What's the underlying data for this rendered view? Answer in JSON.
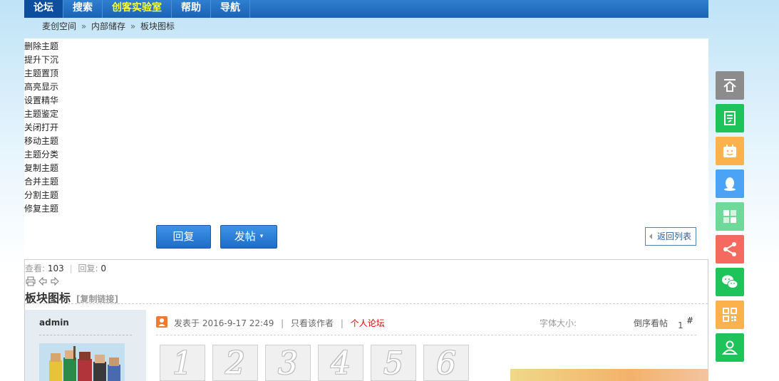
{
  "nav": {
    "items": [
      {
        "label": "论坛"
      },
      {
        "label": "搜索"
      },
      {
        "label": "创客实验室"
      },
      {
        "label": "帮助"
      },
      {
        "label": "导航"
      }
    ]
  },
  "breadcrumb": {
    "items": [
      "麦创空间",
      "内部储存",
      "板块图标"
    ],
    "separator": "»"
  },
  "moderation": {
    "items": [
      "删除主题",
      "提升下沉",
      "主题置顶",
      "高亮显示",
      "设置精华",
      "主题鉴定",
      "关闭打开",
      "移动主题",
      "主题分类",
      "复制主题",
      "合并主题",
      "分割主题",
      "修复主题"
    ]
  },
  "actions": {
    "reply_label": "回复",
    "post_label": "发帖",
    "post_caret": "▾",
    "back_label": "返回列表"
  },
  "thread": {
    "views_label": "查看:",
    "views": "103",
    "replies_label": "回复:",
    "replies": "0",
    "title": "板块图标",
    "copy_link_label": "[复制链接]"
  },
  "post": {
    "author": "admin",
    "posted_prefix": "发表于",
    "posted_time": "2016-9-17 22:49",
    "only_author_label": "只看该作者",
    "personal_forum_label": "个人论坛",
    "font_size_label": "字体大小:",
    "reverse_label": "倒序看帖",
    "floor_number": "1",
    "floor_hash": "#"
  },
  "number_icons": [
    "1",
    "2",
    "3",
    "4",
    "5",
    "6"
  ],
  "colors": {
    "nav_bg": "#1b62b4",
    "nav_active": "#0d4f9e",
    "nav_highlight": "#ffff33",
    "button_blue": "#1f6cc8",
    "personal_forum": "#e00000",
    "side_top": "#8c8c8c",
    "side_green": "#1ec35a",
    "side_orange": "#fbb24d",
    "side_blue": "#4aa3f5",
    "side_lightgreen": "#6fd99a",
    "side_red": "#f46a5e"
  },
  "side_toolbar": [
    {
      "icon": "back-to-top-icon"
    },
    {
      "icon": "document-edit-icon"
    },
    {
      "icon": "calendar-face-icon"
    },
    {
      "icon": "qq-penguin-icon"
    },
    {
      "icon": "apps-grid-icon"
    },
    {
      "icon": "share-icon"
    },
    {
      "icon": "wechat-icon"
    },
    {
      "icon": "qrcode-icon"
    },
    {
      "icon": "user-profile-icon"
    }
  ]
}
